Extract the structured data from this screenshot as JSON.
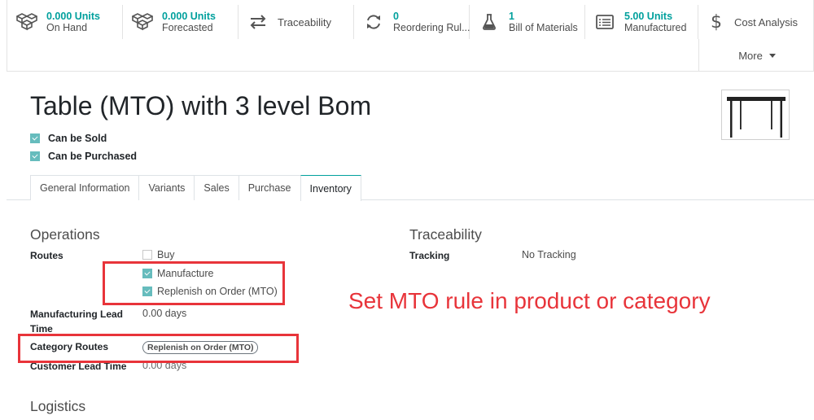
{
  "smart_buttons": [
    {
      "number": "0.000 Units",
      "label": "On Hand",
      "icon": "cubes-icon"
    },
    {
      "number": "0.000 Units",
      "label": "Forecasted",
      "icon": "cubes-icon"
    },
    {
      "label": "Traceability",
      "icon": "exchange-arrows-icon"
    },
    {
      "number": "0",
      "label": "Reordering Rul...",
      "icon": "refresh-icon"
    },
    {
      "number": "1",
      "label": "Bill of Materials",
      "icon": "flask-icon"
    },
    {
      "number": "5.00 Units",
      "label": "Manufactured",
      "icon": "list-icon"
    },
    {
      "label": "Cost Analysis",
      "icon": "dollar-icon"
    }
  ],
  "more_label": "More",
  "product": {
    "title": "Table (MTO) with 3 level Bom",
    "can_be_sold": "Can be Sold",
    "can_be_purchased": "Can be Purchased"
  },
  "tabs": [
    "General Information",
    "Variants",
    "Sales",
    "Purchase",
    "Inventory"
  ],
  "active_tab": "Inventory",
  "operations": {
    "heading": "Operations",
    "routes_label": "Routes",
    "routes": [
      {
        "label": "Buy",
        "checked": false
      },
      {
        "label": "Manufacture",
        "checked": true
      },
      {
        "label": "Replenish on Order (MTO)",
        "checked": true
      }
    ],
    "lead_label_line1": "Manufacturing Lead",
    "lead_label_line2": "Time",
    "lead_value": "0.00 days",
    "category_routes_label": "Category Routes",
    "category_routes_badge": "Replenish on Order (MTO)",
    "customer_lead_label": "Customer Lead Time",
    "customer_lead_value": "0.00 days"
  },
  "traceability": {
    "heading": "Traceability",
    "tracking_label": "Tracking",
    "tracking_value": "No Tracking"
  },
  "logistics": {
    "heading": "Logistics"
  },
  "annotation": {
    "text": "Set MTO rule in product or category",
    "color": "#e8343a"
  },
  "colors": {
    "accent": "#00a09d",
    "checkbox": "#66bcbd"
  }
}
